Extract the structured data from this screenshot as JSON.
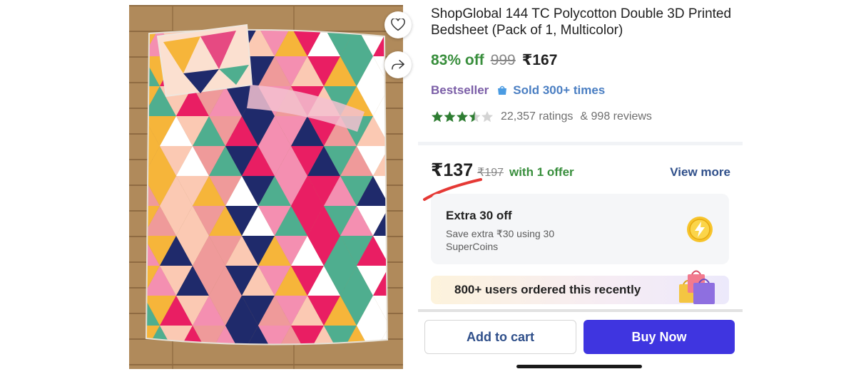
{
  "product": {
    "title": "ShopGlobal 144 TC Polycotton Double 3D Printed Bedsheet (Pack of 1, Multicolor)",
    "discount": "83% off",
    "mrp": "999",
    "price": "₹167",
    "image_alt": "bedsheet-product-image"
  },
  "badges": {
    "bestseller": "Bestseller",
    "sold": "Sold 300+ times"
  },
  "rating": {
    "stars": 3.5,
    "ratings_text": "22,357 ratings",
    "reviews_text": "& 998 reviews"
  },
  "offer": {
    "price": "₹137",
    "mrp": "₹197",
    "label": "with 1 offer",
    "view_more": "View more"
  },
  "supercoins": {
    "title": "Extra 30 off",
    "description": "Save extra ₹30 using 30 SuperCoins"
  },
  "social_proof": {
    "text": "800+ users ordered this recently"
  },
  "actions": {
    "add_to_cart": "Add to cart",
    "buy_now": "Buy Now"
  },
  "icons": {
    "wishlist": "heart-icon",
    "share": "share-icon",
    "supercoin": "lightning-coin-icon",
    "shopping_bags": "shopping-bags-icon"
  },
  "colors": {
    "discount_green": "#388e3c",
    "bestseller_purple": "#7b5ea7",
    "sold_blue": "#4a7ec2",
    "buy_now_bg": "#3f35e0",
    "star_green": "#2e7d32",
    "annotation_red": "#e53935"
  }
}
